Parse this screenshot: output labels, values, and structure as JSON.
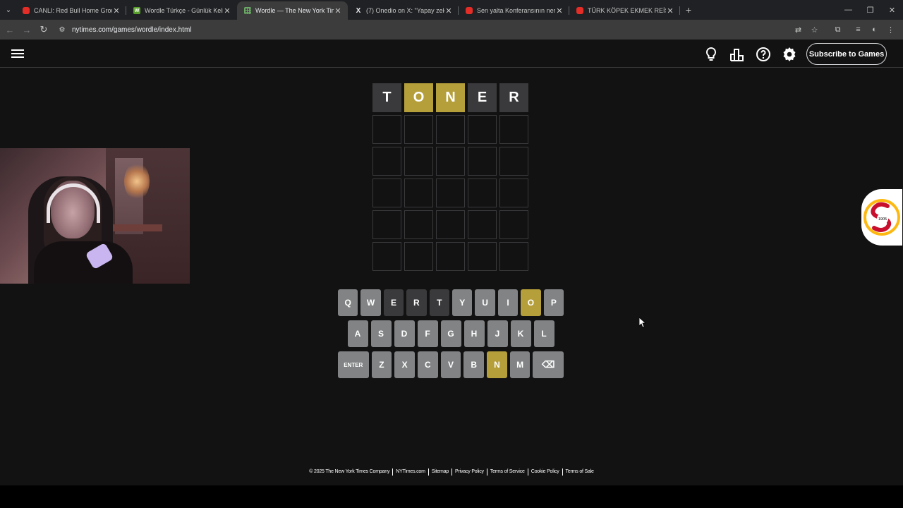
{
  "browser": {
    "tabs": [
      {
        "title": "CANLI: Red Bull Home Ground",
        "favicon": "youtube-icon",
        "active": false
      },
      {
        "title": "Wordle Türkçe - Günlük Kelime",
        "favicon": "w-icon",
        "active": false
      },
      {
        "title": "Wordle — The New York Times",
        "favicon": "wordle-grid-icon",
        "active": true
      },
      {
        "title": "(7) Onedio on X: \"Yapay zeka ile",
        "favicon": "x-icon",
        "active": false
      },
      {
        "title": "Sen yalta Konferansının nerde",
        "favicon": "youtube-icon",
        "active": false
      },
      {
        "title": "TÜRK KÖPEK EKMEK REİS'İ NAS",
        "favicon": "youtube-icon",
        "active": false
      }
    ],
    "close_glyph": "✕",
    "new_tab_glyph": "+",
    "url": "nytimes.com/games/wordle/index.html"
  },
  "header": {
    "subscribe_label": "Subscribe to Games"
  },
  "board": {
    "rows": [
      [
        {
          "letter": "T",
          "state": "absent"
        },
        {
          "letter": "O",
          "state": "present"
        },
        {
          "letter": "N",
          "state": "present"
        },
        {
          "letter": "E",
          "state": "absent"
        },
        {
          "letter": "R",
          "state": "absent"
        }
      ],
      [
        {
          "letter": "",
          "state": "empty"
        },
        {
          "letter": "",
          "state": "empty"
        },
        {
          "letter": "",
          "state": "empty"
        },
        {
          "letter": "",
          "state": "empty"
        },
        {
          "letter": "",
          "state": "empty"
        }
      ],
      [
        {
          "letter": "",
          "state": "empty"
        },
        {
          "letter": "",
          "state": "empty"
        },
        {
          "letter": "",
          "state": "empty"
        },
        {
          "letter": "",
          "state": "empty"
        },
        {
          "letter": "",
          "state": "empty"
        }
      ],
      [
        {
          "letter": "",
          "state": "empty"
        },
        {
          "letter": "",
          "state": "empty"
        },
        {
          "letter": "",
          "state": "empty"
        },
        {
          "letter": "",
          "state": "empty"
        },
        {
          "letter": "",
          "state": "empty"
        }
      ],
      [
        {
          "letter": "",
          "state": "empty"
        },
        {
          "letter": "",
          "state": "empty"
        },
        {
          "letter": "",
          "state": "empty"
        },
        {
          "letter": "",
          "state": "empty"
        },
        {
          "letter": "",
          "state": "empty"
        }
      ],
      [
        {
          "letter": "",
          "state": "empty"
        },
        {
          "letter": "",
          "state": "empty"
        },
        {
          "letter": "",
          "state": "empty"
        },
        {
          "letter": "",
          "state": "empty"
        },
        {
          "letter": "",
          "state": "empty"
        }
      ]
    ]
  },
  "keyboard": {
    "rows": [
      [
        {
          "label": "Q",
          "state": "unused"
        },
        {
          "label": "W",
          "state": "unused"
        },
        {
          "label": "E",
          "state": "absent"
        },
        {
          "label": "R",
          "state": "absent"
        },
        {
          "label": "T",
          "state": "absent"
        },
        {
          "label": "Y",
          "state": "unused"
        },
        {
          "label": "U",
          "state": "unused"
        },
        {
          "label": "I",
          "state": "unused"
        },
        {
          "label": "O",
          "state": "present"
        },
        {
          "label": "P",
          "state": "unused"
        }
      ],
      [
        {
          "label": "A",
          "state": "unused"
        },
        {
          "label": "S",
          "state": "unused"
        },
        {
          "label": "D",
          "state": "unused"
        },
        {
          "label": "F",
          "state": "unused"
        },
        {
          "label": "G",
          "state": "unused"
        },
        {
          "label": "H",
          "state": "unused"
        },
        {
          "label": "J",
          "state": "unused"
        },
        {
          "label": "K",
          "state": "unused"
        },
        {
          "label": "L",
          "state": "unused"
        }
      ],
      [
        {
          "label": "ENTER",
          "state": "unused",
          "wide": true
        },
        {
          "label": "Z",
          "state": "unused"
        },
        {
          "label": "X",
          "state": "unused"
        },
        {
          "label": "C",
          "state": "unused"
        },
        {
          "label": "V",
          "state": "unused"
        },
        {
          "label": "B",
          "state": "unused"
        },
        {
          "label": "N",
          "state": "present"
        },
        {
          "label": "M",
          "state": "unused"
        },
        {
          "label": "⌫",
          "state": "unused",
          "wide": true,
          "icon": "backspace-icon"
        }
      ]
    ]
  },
  "footer": {
    "links": [
      "© 2025 The New York Times Company",
      "NYTimes.com",
      "Sitemap",
      "Privacy Policy",
      "Terms of Service",
      "Cookie Policy",
      "Terms of Sale"
    ]
  },
  "overlay": {
    "badge_year": "1905"
  },
  "colors": {
    "background": "#121213",
    "absent": "#3a3a3c",
    "present": "#b59f3b",
    "correct": "#538d4e",
    "key_unused": "#818384",
    "galatasaray_red": "#c8102e",
    "galatasaray_yellow": "#fdb912"
  }
}
